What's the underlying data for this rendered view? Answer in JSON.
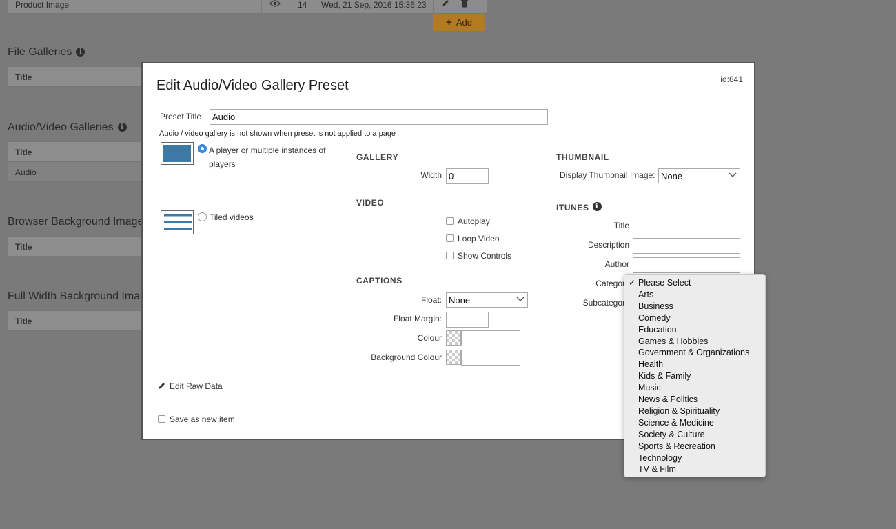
{
  "background": {
    "product_row": {
      "title": "Product Image",
      "count": "14",
      "date": "Wed, 21 Sep, 2016 15:36:23"
    },
    "add_label": "Add",
    "sections": [
      {
        "title": "File Galleries",
        "head": "Title"
      },
      {
        "title": "Audio/Video Galleries",
        "head": "Title",
        "row": "Audio"
      },
      {
        "title": "Browser Background Image",
        "head": "Title"
      },
      {
        "title": "Full Width Background Image",
        "head": "Title"
      }
    ]
  },
  "modal": {
    "title": "Edit Audio/Video Gallery Preset",
    "id": "id:841",
    "preset_title_label": "Preset Title",
    "preset_title_value": "Audio",
    "notice": "Audio / video gallery is not shown when preset is not applied to a page",
    "layout_options": [
      {
        "label": "A player or multiple instances of players",
        "selected": true
      },
      {
        "label": "Tiled videos",
        "selected": false
      }
    ],
    "gallery": {
      "heading": "GALLERY",
      "width_label": "Width",
      "width_value": "0"
    },
    "video": {
      "heading": "VIDEO",
      "autoplay": "Autoplay",
      "loop": "Loop Video",
      "controls": "Show Controls"
    },
    "captions": {
      "heading": "CAPTIONS",
      "float_label": "Float:",
      "float_value": "None",
      "float_margin_label": "Float Margin:",
      "colour_label": "Colour",
      "bg_colour_label": "Background Colour"
    },
    "thumbnail": {
      "heading": "THUMBNAIL",
      "display_label": "Display Thumbnail Image:",
      "display_value": "None"
    },
    "itunes": {
      "heading": "ITUNES",
      "title_label": "Title",
      "description_label": "Description",
      "author_label": "Author",
      "category_label": "Category",
      "subcategory_label": "Subcategory"
    },
    "edit_raw_data": "Edit Raw Data",
    "save_as_new": "Save as new item"
  },
  "category_dropdown": {
    "selected": "Please Select",
    "options": [
      "Please Select",
      "Arts",
      "Business",
      "Comedy",
      "Education",
      "Games & Hobbies",
      "Government & Organizations",
      "Health",
      "Kids & Family",
      "Music",
      "News & Politics",
      "Religion & Spirituality",
      "Science & Medicine",
      "Society & Culture",
      "Sports & Recreation",
      "Technology",
      "TV & Film"
    ]
  },
  "colors": {
    "overlay": "#7a7a7a",
    "accent_blue": "#3a8ee6",
    "add_button": "#b27a22",
    "thumb_blue": "#3f7aa6"
  }
}
